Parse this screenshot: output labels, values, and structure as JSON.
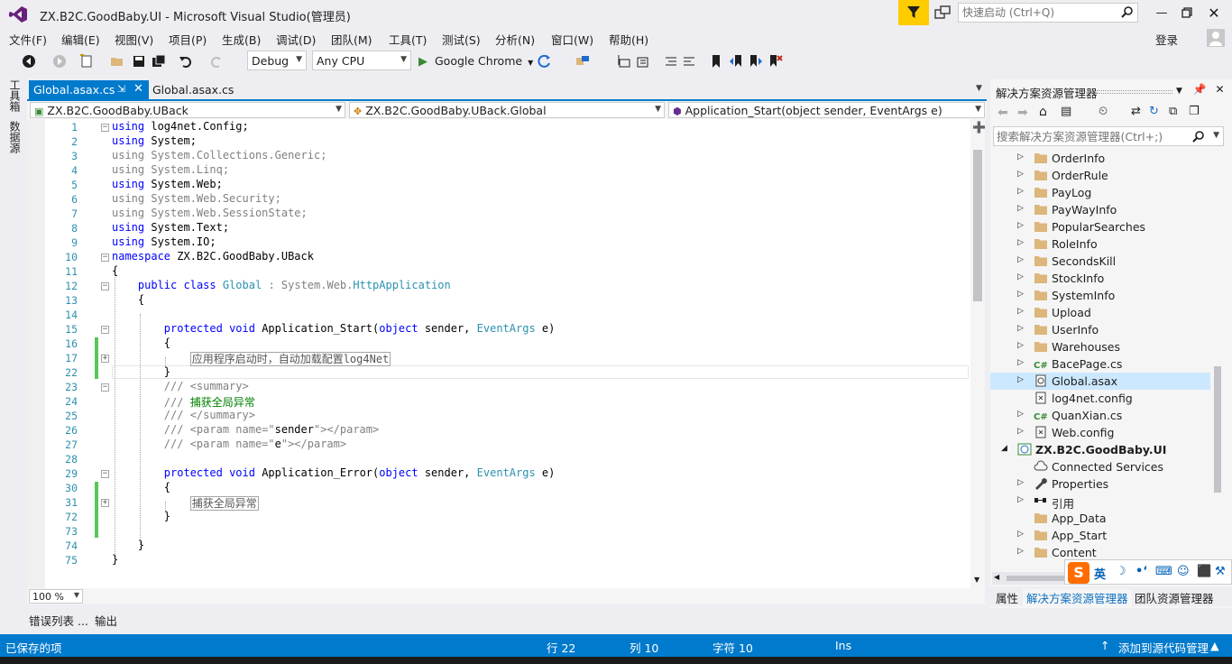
{
  "window": {
    "title": "ZX.B2C.GoodBaby.UI - Microsoft Visual Studio(管理员)",
    "quick_launch_placeholder": "快速启动 (Ctrl+Q)",
    "login": "登录"
  },
  "menu": [
    "文件(F)",
    "编辑(E)",
    "视图(V)",
    "项目(P)",
    "生成(B)",
    "调试(D)",
    "团队(M)",
    "工具(T)",
    "测试(S)",
    "分析(N)",
    "窗口(W)",
    "帮助(H)"
  ],
  "toolbar": {
    "config": "Debug",
    "platform": "Any CPU",
    "run_target": "Google Chrome"
  },
  "left_strip": [
    "工具箱",
    "数据源"
  ],
  "doc_tabs": [
    {
      "label": "Global.asax.cs",
      "active": true
    },
    {
      "label": "Global.asax.cs",
      "active": false
    }
  ],
  "navbar": {
    "project": "ZX.B2C.GoodBaby.UBack",
    "class": "ZX.B2C.GoodBaby.UBack.Global",
    "member": "Application_Start(object sender, EventArgs e)"
  },
  "code": {
    "line_numbers": [
      "1",
      "2",
      "3",
      "4",
      "5",
      "6",
      "7",
      "8",
      "9",
      "10",
      "11",
      "12",
      "13",
      "14",
      "15",
      "16",
      "17",
      "22",
      "23",
      "24",
      "25",
      "26",
      "27",
      "28",
      "29",
      "30",
      "31",
      "72",
      "73",
      "74",
      "75"
    ],
    "collapsed_1": "应用程序启动时，自动加载配置log4Net",
    "collapsed_2": "捕获全局异常",
    "summary_comment": "捕获全局异常"
  },
  "zoom": "100 %",
  "bottom_tabs": [
    "错误列表 ...",
    "输出"
  ],
  "status": {
    "message": "已保存的项",
    "line": "行 22",
    "col": "列 10",
    "char": "字符 10",
    "mode": "Ins",
    "source_control": "添加到源代码管理"
  },
  "solution_explorer": {
    "title": "解决方案资源管理器",
    "search_placeholder": "搜索解决方案资源管理器(Ctrl+;)",
    "items": [
      {
        "label": "OrderInfo",
        "kind": "folder",
        "indent": 1,
        "expander": "collapsed"
      },
      {
        "label": "OrderRule",
        "kind": "folder",
        "indent": 1,
        "expander": "collapsed"
      },
      {
        "label": "PayLog",
        "kind": "folder",
        "indent": 1,
        "expander": "collapsed"
      },
      {
        "label": "PayWayInfo",
        "kind": "folder",
        "indent": 1,
        "expander": "collapsed"
      },
      {
        "label": "PopularSearches",
        "kind": "folder",
        "indent": 1,
        "expander": "collapsed"
      },
      {
        "label": "RoleInfo",
        "kind": "folder",
        "indent": 1,
        "expander": "collapsed"
      },
      {
        "label": "SecondsKill",
        "kind": "folder",
        "indent": 1,
        "expander": "collapsed"
      },
      {
        "label": "StockInfo",
        "kind": "folder",
        "indent": 1,
        "expander": "collapsed"
      },
      {
        "label": "SystemInfo",
        "kind": "folder",
        "indent": 1,
        "expander": "collapsed"
      },
      {
        "label": "Upload",
        "kind": "folder",
        "indent": 1,
        "expander": "collapsed"
      },
      {
        "label": "UserInfo",
        "kind": "folder",
        "indent": 1,
        "expander": "collapsed"
      },
      {
        "label": "Warehouses",
        "kind": "folder",
        "indent": 1,
        "expander": "collapsed"
      },
      {
        "label": "BacePage.cs",
        "kind": "cs",
        "indent": 1,
        "expander": "collapsed"
      },
      {
        "label": "Global.asax",
        "kind": "asax",
        "indent": 1,
        "expander": "collapsed",
        "selected": true
      },
      {
        "label": "log4net.config",
        "kind": "config",
        "indent": 1,
        "expander": "none"
      },
      {
        "label": "QuanXian.cs",
        "kind": "cs",
        "indent": 1,
        "expander": "collapsed"
      },
      {
        "label": "Web.config",
        "kind": "config",
        "indent": 1,
        "expander": "collapsed"
      },
      {
        "label": "ZX.B2C.GoodBaby.UI",
        "kind": "project",
        "indent": 0,
        "expander": "expanded",
        "bold": true
      },
      {
        "label": "Connected Services",
        "kind": "cloud",
        "indent": 1,
        "expander": "none"
      },
      {
        "label": "Properties",
        "kind": "wrench",
        "indent": 1,
        "expander": "collapsed"
      },
      {
        "label": "引用",
        "kind": "ref",
        "indent": 1,
        "expander": "collapsed"
      },
      {
        "label": "App_Data",
        "kind": "folder",
        "indent": 1,
        "expander": "none"
      },
      {
        "label": "App_Start",
        "kind": "folder",
        "indent": 1,
        "expander": "collapsed"
      },
      {
        "label": "Content",
        "kind": "folder",
        "indent": 1,
        "expander": "collapsed"
      }
    ],
    "bottom_tabs": [
      "属性",
      "解决方案资源管理器",
      "团队资源管理器"
    ]
  },
  "ime": {
    "mode": "英"
  },
  "colors": {
    "accent": "#007acc",
    "filter": "#ffcc00",
    "folder": "#dcb67a"
  }
}
